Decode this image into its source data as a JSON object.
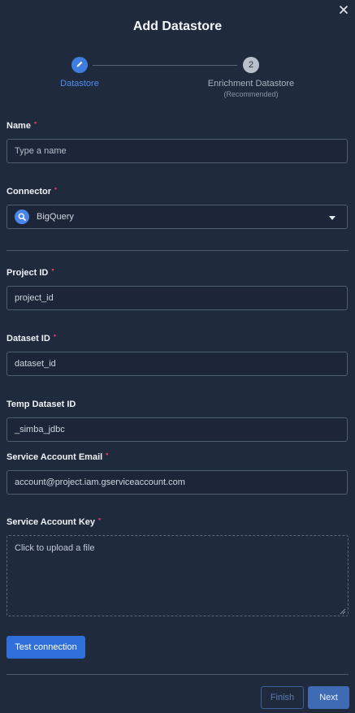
{
  "dialog": {
    "title": "Add Datastore",
    "close_icon": "close-icon"
  },
  "stepper": {
    "steps": [
      {
        "label": "Datastore",
        "state": "active",
        "icon": "pencil-icon"
      },
      {
        "label": "Enrichment Datastore",
        "sublabel": "(Recommended)",
        "number": "2",
        "state": "inactive"
      }
    ]
  },
  "fields": {
    "name": {
      "label": "Name",
      "required": "•",
      "placeholder": "Type a name"
    },
    "connector": {
      "label": "Connector",
      "required": "•",
      "value": "BigQuery",
      "icon": "bigquery-icon"
    },
    "project_id": {
      "label": "Project ID",
      "required": "•",
      "value": "project_id"
    },
    "dataset_id": {
      "label": "Dataset ID",
      "required": "•",
      "value": "dataset_id"
    },
    "temp_dataset_id": {
      "label": "Temp Dataset ID",
      "value": "_simba_jdbc"
    },
    "service_account_email": {
      "label": "Service Account Email",
      "required": "•",
      "value": "account@project.iam.gserviceaccount.com"
    },
    "service_account_key": {
      "label": "Service Account Key",
      "required": "•",
      "upload_text": "Click to upload a file"
    }
  },
  "actions": {
    "test_connection": "Test connection",
    "finish": "Finish",
    "next": "Next"
  },
  "colors": {
    "background": "#1f2a3c",
    "accent": "#3f7de0",
    "required": "#e8386a"
  }
}
